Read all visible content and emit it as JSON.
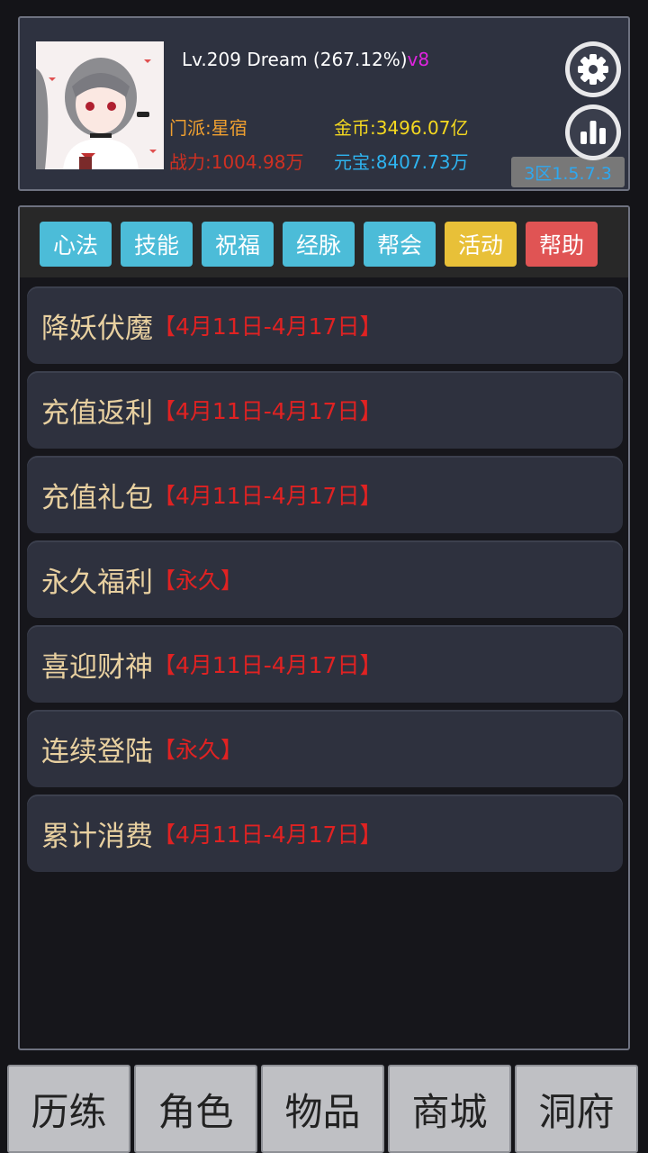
{
  "player": {
    "level": "Lv.209",
    "name": "Dream",
    "exp_pct": "(267.12%)",
    "vip": "v8",
    "sect": "门派:星宿",
    "power": "战力:1004.98万",
    "gold": "金币:3496.07亿",
    "ingot": "元宝:8407.73万",
    "server_version": "3区1.5.7.3"
  },
  "icons": {
    "settings": "gear-icon",
    "stats": "bar-chart-icon"
  },
  "tabs": [
    {
      "label": "心法",
      "color": "#4cbcd8"
    },
    {
      "label": "技能",
      "color": "#4cbcd8"
    },
    {
      "label": "祝福",
      "color": "#4cbcd8"
    },
    {
      "label": "经脉",
      "color": "#4cbcd8"
    },
    {
      "label": "帮会",
      "color": "#4cbcd8"
    },
    {
      "label": "活动",
      "color": "#e8c038"
    },
    {
      "label": "帮助",
      "color": "#e05454"
    }
  ],
  "events": [
    {
      "name": "降妖伏魔",
      "date": "【4月11日-4月17日】"
    },
    {
      "name": "充值返利",
      "date": "【4月11日-4月17日】"
    },
    {
      "name": "充值礼包",
      "date": "【4月11日-4月17日】"
    },
    {
      "name": "永久福利",
      "date": "【永久】"
    },
    {
      "name": "喜迎财神",
      "date": "【4月11日-4月17日】"
    },
    {
      "name": "连续登陆",
      "date": "【永久】"
    },
    {
      "name": "累计消费",
      "date": "【4月11日-4月17日】"
    }
  ],
  "bottom_nav": [
    {
      "label": "历练"
    },
    {
      "label": "角色"
    },
    {
      "label": "物品"
    },
    {
      "label": "商城"
    },
    {
      "label": "洞府"
    }
  ]
}
